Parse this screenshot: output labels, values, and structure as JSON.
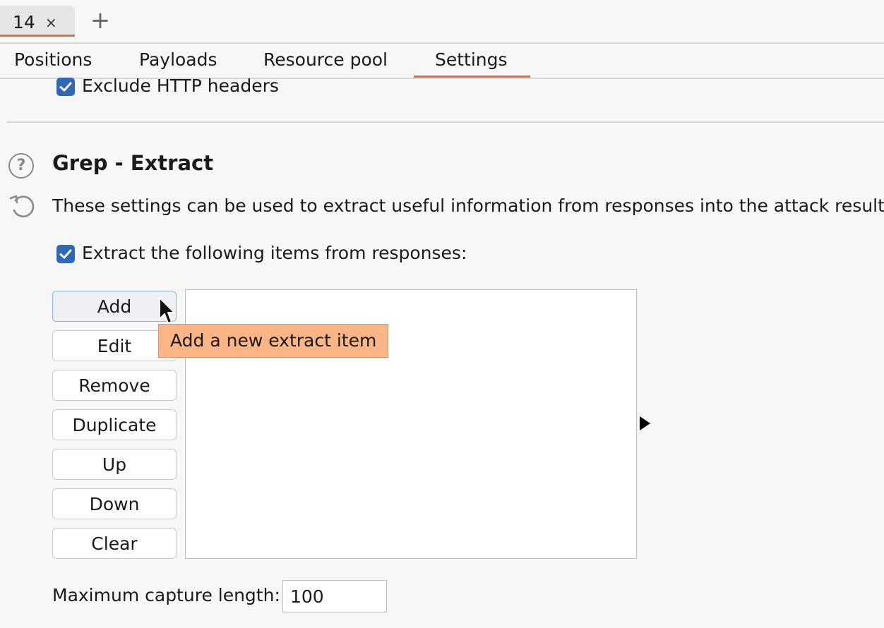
{
  "doc_tab": {
    "label": "14",
    "close_glyph": "×"
  },
  "new_tab_glyph": "+",
  "sub_tabs": [
    {
      "label": "Positions",
      "active": false
    },
    {
      "label": "Payloads",
      "active": false
    },
    {
      "label": "Resource pool",
      "active": false
    },
    {
      "label": "Settings",
      "active": true
    }
  ],
  "exclude_headers": {
    "label": "Exclude HTTP headers",
    "checked": true
  },
  "section": {
    "title": "Grep - Extract",
    "description": "These settings can be used to extract useful information from responses into the attack results t",
    "help_icon": "help-circle-icon",
    "reset_icon": "reset-icon"
  },
  "extract_items": {
    "label": "Extract the following items from responses:",
    "checked": true
  },
  "buttons": {
    "add": "Add",
    "edit": "Edit",
    "remove": "Remove",
    "duplicate": "Duplicate",
    "up": "Up",
    "down": "Down",
    "clear": "Clear"
  },
  "tooltip": {
    "text": "Add a new extract item"
  },
  "max_capture": {
    "label": "Maximum capture length:",
    "value": "100"
  },
  "colors": {
    "accent": "#ef6a3a",
    "checkbox": "#2f68b5",
    "tooltip_bg": "#fcb585"
  }
}
